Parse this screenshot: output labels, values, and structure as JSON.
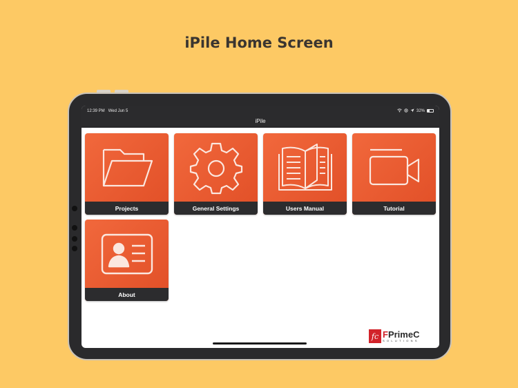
{
  "page": {
    "heading": "iPile Home Screen"
  },
  "status_bar": {
    "time": "12:39 PM",
    "date": "Wed Jun 5",
    "battery": "32%"
  },
  "nav": {
    "title": "iPile"
  },
  "tiles": [
    {
      "label": "Projects",
      "icon": "folder-icon"
    },
    {
      "label": "General Settings",
      "icon": "gear-icon"
    },
    {
      "label": "Users Manual",
      "icon": "book-icon"
    },
    {
      "label": "Tutorial",
      "icon": "video-camera-icon"
    },
    {
      "label": "About",
      "icon": "contact-card-icon"
    }
  ],
  "brand": {
    "mark": "fc",
    "name_accent": "F",
    "name_rest": "PrimeC",
    "sub": "SOLUTIONS"
  },
  "colors": {
    "background": "#fdc964",
    "tile_orange": "#e8582f",
    "label_bar": "#2c2c2e",
    "brand_red": "#d2232a"
  }
}
